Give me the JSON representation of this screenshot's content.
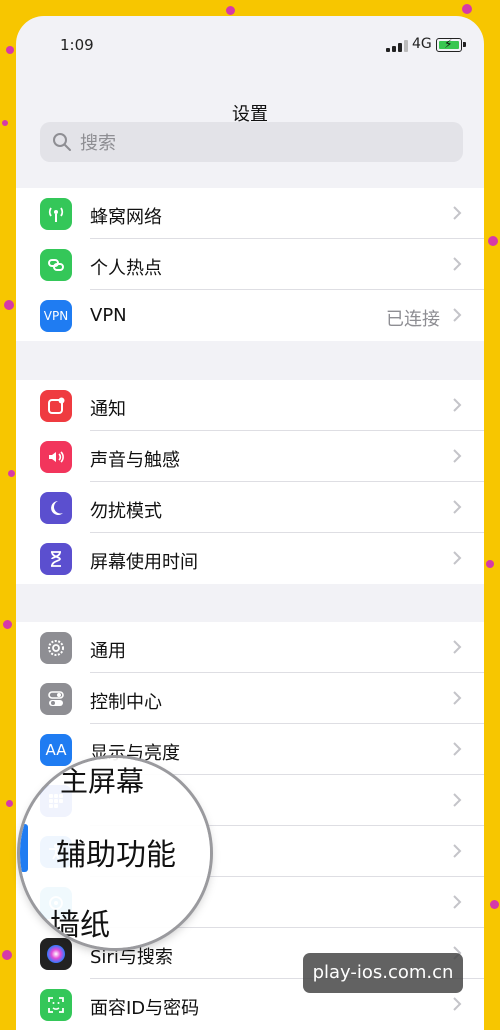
{
  "status_bar": {
    "time": "1:09",
    "network": "4G"
  },
  "nav": {
    "title": "设置"
  },
  "search": {
    "placeholder": "搜索"
  },
  "groups": {
    "g1": [
      {
        "label": "蜂窝网络",
        "icon": "antenna-icon",
        "color": "#34c759"
      },
      {
        "label": "个人热点",
        "icon": "hotspot-link-icon",
        "color": "#34c759"
      },
      {
        "label": "VPN",
        "value": "已连接",
        "icon": "vpn-icon",
        "icon_text": "VPN",
        "color": "#1f7cf2"
      }
    ],
    "g2": [
      {
        "label": "通知",
        "icon": "notification-icon",
        "color": "#ef3b40"
      },
      {
        "label": "声音与触感",
        "icon": "speaker-icon",
        "color": "#f2355c"
      },
      {
        "label": "勿扰模式",
        "icon": "moon-icon",
        "color": "#5b4fcf"
      },
      {
        "label": "屏幕使用时间",
        "icon": "hourglass-icon",
        "color": "#5b4fcf"
      }
    ],
    "g3": [
      {
        "label": "通用",
        "icon": "gear-icon",
        "color": "#8e8e93"
      },
      {
        "label": "控制中心",
        "icon": "toggles-icon",
        "color": "#8e8e93"
      },
      {
        "label": "显示与亮度",
        "icon": "text-size-icon",
        "icon_text": "AA",
        "color": "#1f7cf2"
      },
      {
        "label": "",
        "icon": "home-screen-icon",
        "color": "#2a56d8"
      },
      {
        "label": "",
        "icon": "accessibility-icon",
        "color": "#1f7cf2"
      },
      {
        "label": "",
        "icon": "wallpaper-icon",
        "color": "#35aadc"
      },
      {
        "label": "Siri与搜索",
        "icon": "siri-icon",
        "color": "#222222"
      },
      {
        "label": "面容ID与密码",
        "icon": "face-id-icon",
        "color": "#34c759"
      }
    ]
  },
  "magnifier": {
    "top_text": "主屏幕",
    "center_text": "辅助功能",
    "bottom_text": "墙纸"
  },
  "watermark": {
    "text": "play-ios.com.cn"
  },
  "colors": {
    "background": "#f7c600",
    "dots": "#d63aa8",
    "group_bg": "#ffffff",
    "page_bg": "#f2f2f6"
  }
}
